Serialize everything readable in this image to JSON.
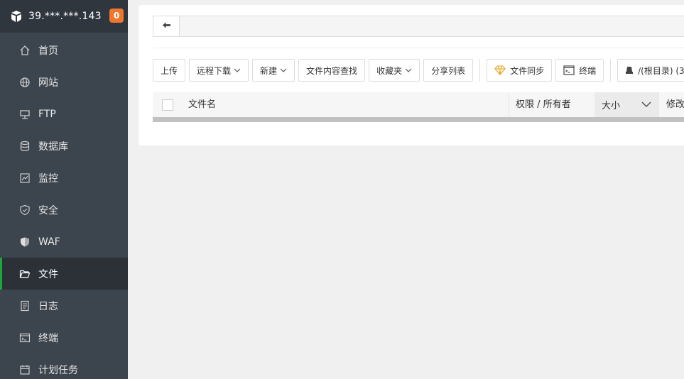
{
  "sidebar": {
    "server_ip": "39.***.***.143",
    "badge_count": "0",
    "items": [
      {
        "label": "首页",
        "icon": "home-icon"
      },
      {
        "label": "网站",
        "icon": "globe-icon"
      },
      {
        "label": "FTP",
        "icon": "ftp-icon"
      },
      {
        "label": "数据库",
        "icon": "database-icon"
      },
      {
        "label": "监控",
        "icon": "monitor-icon"
      },
      {
        "label": "安全",
        "icon": "shield-icon"
      },
      {
        "label": "WAF",
        "icon": "waf-shield-icon"
      },
      {
        "label": "文件",
        "icon": "folder-icon"
      },
      {
        "label": "日志",
        "icon": "log-icon"
      },
      {
        "label": "终端",
        "icon": "terminal-icon"
      },
      {
        "label": "计划任务",
        "icon": "calendar-icon"
      }
    ],
    "active_item": "文件"
  },
  "toolbar": {
    "upload": "上传",
    "remote_download": "远程下载",
    "new": "新建",
    "content_search": "文件内容查找",
    "favorites": "收藏夹",
    "share_list": "分享列表",
    "file_sync": "文件同步",
    "terminal": "终端",
    "disk": "/(根目录) (3..."
  },
  "table": {
    "col_name": "文件名",
    "col_perm": "权限 / 所有者",
    "col_size": "大小",
    "col_modified": "修改"
  },
  "colors": {
    "sidebar_bg": "#3c444d",
    "active_accent": "#20a53a",
    "badge": "#f0762e"
  }
}
